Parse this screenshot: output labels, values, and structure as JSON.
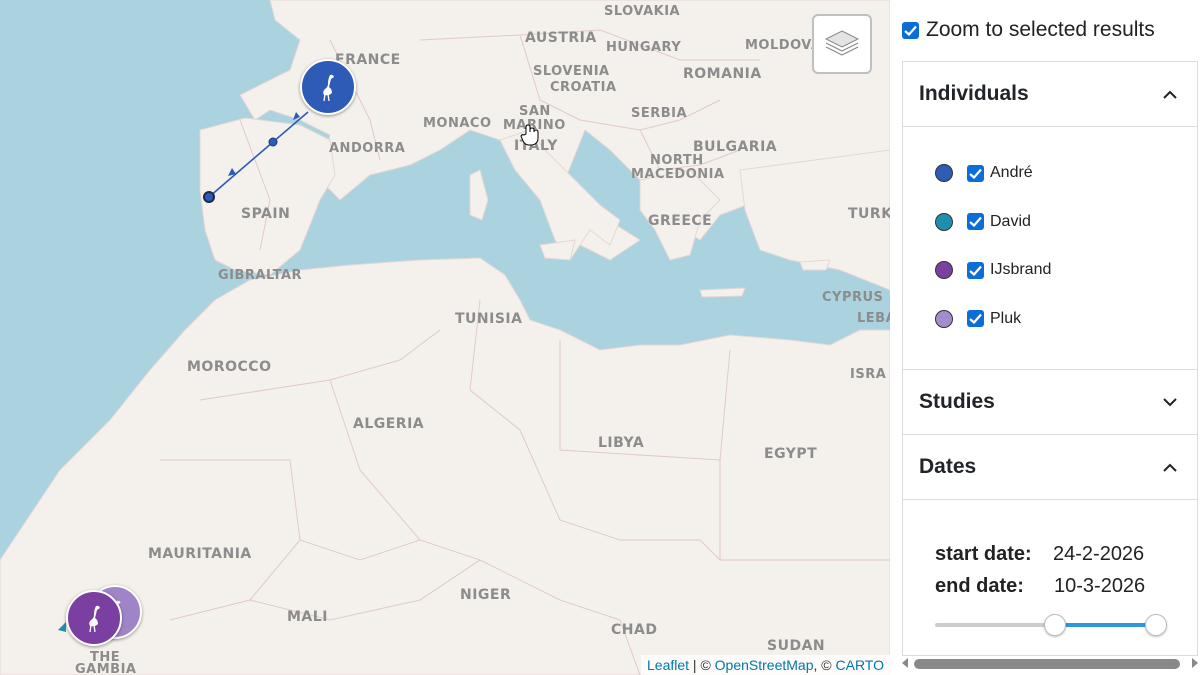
{
  "map": {
    "country_labels": [
      "SLOVAKIA",
      "AUSTRIA",
      "HUNGARY",
      "MOLDOVA",
      "FRANCE",
      "SLOVENIA",
      "CROATIA",
      "ROMANIA",
      "SAN",
      "MARINO",
      "MONACO",
      "SERBIA",
      "ANDORRA",
      "ITALY",
      "BULGARIA",
      "NORTH",
      "MACEDONIA",
      "SPAIN",
      "GREECE",
      "TURK",
      "GIBRALTAR",
      "TUNISIA",
      "CYPRUS",
      "LEBA",
      "MOROCCO",
      "ISRA",
      "ALGERIA",
      "LIBYA",
      "EGYPT",
      "MAURITANIA",
      "NIGER",
      "MALI",
      "CHAD",
      "SUDAN",
      "THE",
      "GAMBIA"
    ],
    "attribution": {
      "leaflet": "Leaflet",
      "sep1": " | © ",
      "osm": "OpenStreetMap",
      "sep2": ", © ",
      "carto": "CARTO"
    },
    "layers_icon": "layers-icon",
    "markers": [
      {
        "individual": "André",
        "color": "#2e5bb5",
        "icon": "stork-icon"
      },
      {
        "individual": "IJsbrand",
        "color": "#7a3fa0",
        "icon": "stork-icon"
      },
      {
        "individual": "Pluk",
        "color": "#9f85c8",
        "icon": "stork-icon"
      }
    ],
    "track_color": "#2e5bb5"
  },
  "panel": {
    "zoom_to_selected": {
      "label": "Zoom to selected results",
      "checked": true
    },
    "individuals": {
      "title": "Individuals",
      "expanded": true,
      "items": [
        {
          "name": "André",
          "color": "#2e5bb5",
          "checked": true
        },
        {
          "name": "David",
          "color": "#1f8fb0",
          "checked": true
        },
        {
          "name": "IJsbrand",
          "color": "#7a3fa0",
          "checked": true
        },
        {
          "name": "Pluk",
          "color": "#a48cd0",
          "checked": true
        }
      ]
    },
    "studies": {
      "title": "Studies",
      "expanded": false
    },
    "dates": {
      "title": "Dates",
      "expanded": true,
      "start_label": "start date:",
      "start_value": "24-2-2026",
      "end_label": "end date:",
      "end_value": "10-3-2026",
      "range_fraction": [
        0.52,
        1.0
      ]
    }
  }
}
